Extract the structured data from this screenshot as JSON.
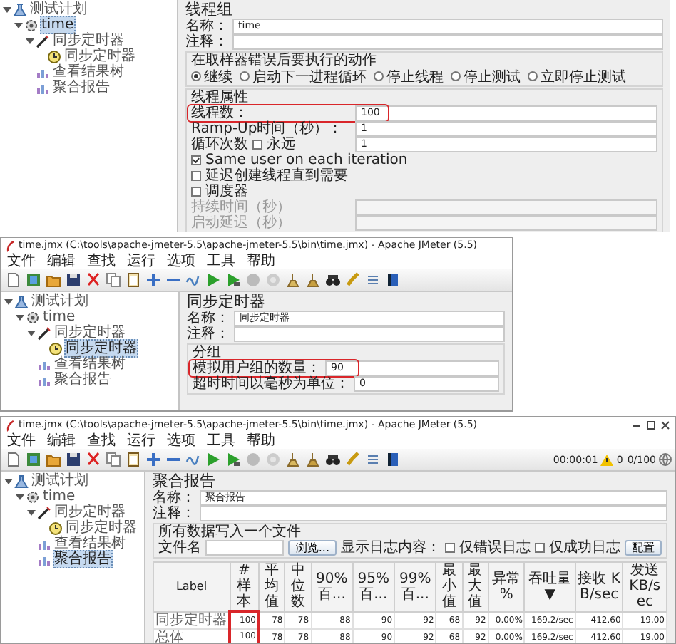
{
  "thread_group_screen": {
    "tree": [
      {
        "label": "测试计划",
        "kind": "plan",
        "selected": false,
        "children": [
          {
            "label": "time",
            "kind": "thread",
            "selected": true,
            "children": [
              {
                "label": "同步定时器",
                "kind": "sampler",
                "selected": false,
                "children": [
                  {
                    "label": "同步定时器",
                    "kind": "timer",
                    "selected": false
                  }
                ]
              },
              {
                "label": "查看结果树",
                "kind": "listener",
                "selected": false
              },
              {
                "label": "聚合报告",
                "kind": "listener",
                "selected": false
              }
            ]
          }
        ]
      }
    ],
    "editor": {
      "title": "线程组",
      "name": {
        "label": "名称：",
        "value": "time"
      },
      "comment": {
        "label": "注释："
      },
      "error_action": {
        "label": "在取样器错误后要执行的动作",
        "options": [
          {
            "label": "继续",
            "selected": true
          },
          {
            "label": "启动下一进程循环",
            "selected": false
          },
          {
            "label": "停止线程",
            "selected": false
          },
          {
            "label": "停止测试",
            "selected": false
          },
          {
            "label": "立即停止测试",
            "selected": false
          }
        ]
      },
      "thread_properties": {
        "label": "线程属性",
        "threads": {
          "label": "线程数：",
          "value": "100",
          "highlighted": true
        },
        "ramp_up": {
          "label": "Ramp-Up时间（秒）：",
          "value": "1"
        },
        "loop_count": {
          "label": "循环次数",
          "forever": {
            "label": "永远",
            "checked": false
          },
          "value": "1"
        },
        "options": [
          {
            "label": "Same user on each iteration",
            "checked": true
          },
          {
            "label": "延迟创建线程直到需要",
            "checked": false
          },
          {
            "label": "调度器",
            "checked": false
          }
        ],
        "scheduler_fields": [
          {
            "label": "持续时间（秒）",
            "disabled": true
          },
          {
            "label": "启动延迟（秒）",
            "disabled": true
          }
        ]
      }
    }
  },
  "timer_window": {
    "title": "time.jmx (C:\\tools\\apache-jmeter-5.5\\apache-jmeter-5.5\\bin\\time.jmx) - Apache JMeter (5.5)",
    "menu": [
      "文件",
      "编辑",
      "查找",
      "运行",
      "选项",
      "工具",
      "帮助"
    ],
    "tree": [
      {
        "label": "测试计划",
        "kind": "plan",
        "selected": false,
        "children": [
          {
            "label": "time",
            "kind": "thread",
            "selected": false,
            "children": [
              {
                "label": "同步定时器",
                "kind": "sampler",
                "selected": false,
                "children": [
                  {
                    "label": "同步定时器",
                    "kind": "timer",
                    "selected": true
                  }
                ]
              },
              {
                "label": "查看结果树",
                "kind": "listener",
                "selected": false
              },
              {
                "label": "聚合报告",
                "kind": "listener",
                "selected": false
              }
            ]
          }
        ]
      }
    ],
    "editor": {
      "title": "同步定时器",
      "name": {
        "label": "名称：",
        "value": "同步定时器"
      },
      "comment": {
        "label": "注释："
      },
      "group": {
        "label": "分组",
        "fields": [
          {
            "label": "模拟用户组的数量：",
            "value": "90",
            "highlighted": true
          },
          {
            "label": "超时时间以毫秒为单位：",
            "value": "0",
            "highlighted": false
          }
        ]
      }
    }
  },
  "report_window": {
    "title": "time.jmx (C:\\tools\\apache-jmeter-5.5\\apache-jmeter-5.5\\bin\\time.jmx) - Apache JMeter (5.5)",
    "menu": [
      "文件",
      "编辑",
      "查找",
      "运行",
      "选项",
      "工具",
      "帮助"
    ],
    "status": {
      "elapsed": "00:00:01",
      "errors": "0",
      "threads": "0/100"
    },
    "tree": [
      {
        "label": "测试计划",
        "kind": "plan",
        "selected": false,
        "children": [
          {
            "label": "time",
            "kind": "thread",
            "selected": false,
            "children": [
              {
                "label": "同步定时器",
                "kind": "sampler",
                "selected": false,
                "children": [
                  {
                    "label": "同步定时器",
                    "kind": "timer",
                    "selected": false
                  }
                ]
              },
              {
                "label": "查看结果树",
                "kind": "listener",
                "selected": false
              },
              {
                "label": "聚合报告",
                "kind": "listener",
                "selected": true
              }
            ]
          }
        ]
      }
    ],
    "editor": {
      "title": "聚合报告",
      "name": {
        "label": "名称：",
        "value": "聚合报告"
      },
      "comment": {
        "label": "注释："
      },
      "file_group": {
        "label": "所有数据写入一个文件",
        "filename_label": "文件名",
        "browse_button": "浏览...",
        "log_label": "显示日志内容：",
        "log_options": [
          {
            "label": "仅错误日志",
            "checked": false
          },
          {
            "label": "仅成功日志",
            "checked": false
          }
        ],
        "config_button": "配置"
      },
      "table": {
        "columns": [
          {
            "label": "Label",
            "highlighted": false
          },
          {
            "label": "# 样本",
            "highlighted": true
          },
          {
            "label": "平均值",
            "highlighted": false
          },
          {
            "label": "中位数",
            "highlighted": false
          },
          {
            "label": "90% 百...",
            "highlighted": false
          },
          {
            "label": "95% 百...",
            "highlighted": false
          },
          {
            "label": "99% 百...",
            "highlighted": false
          },
          {
            "label": "最小值",
            "highlighted": false
          },
          {
            "label": "最大值",
            "highlighted": false
          },
          {
            "label": "异常 %",
            "highlighted": false
          },
          {
            "label": "吞吐量 ▼",
            "highlighted": false
          },
          {
            "label": "接收 KB/sec",
            "highlighted": false
          },
          {
            "label": "发送 KB/sec",
            "highlighted": false
          }
        ],
        "rows": [
          [
            "同步定时器",
            "100",
            "78",
            "78",
            "88",
            "90",
            "92",
            "68",
            "92",
            "0.00%",
            "169.2/sec",
            "412.60",
            "19.00"
          ],
          [
            "总体",
            "100",
            "78",
            "78",
            "88",
            "90",
            "92",
            "68",
            "92",
            "0.00%",
            "169.2/sec",
            "412.60",
            "19.00"
          ]
        ]
      }
    }
  }
}
